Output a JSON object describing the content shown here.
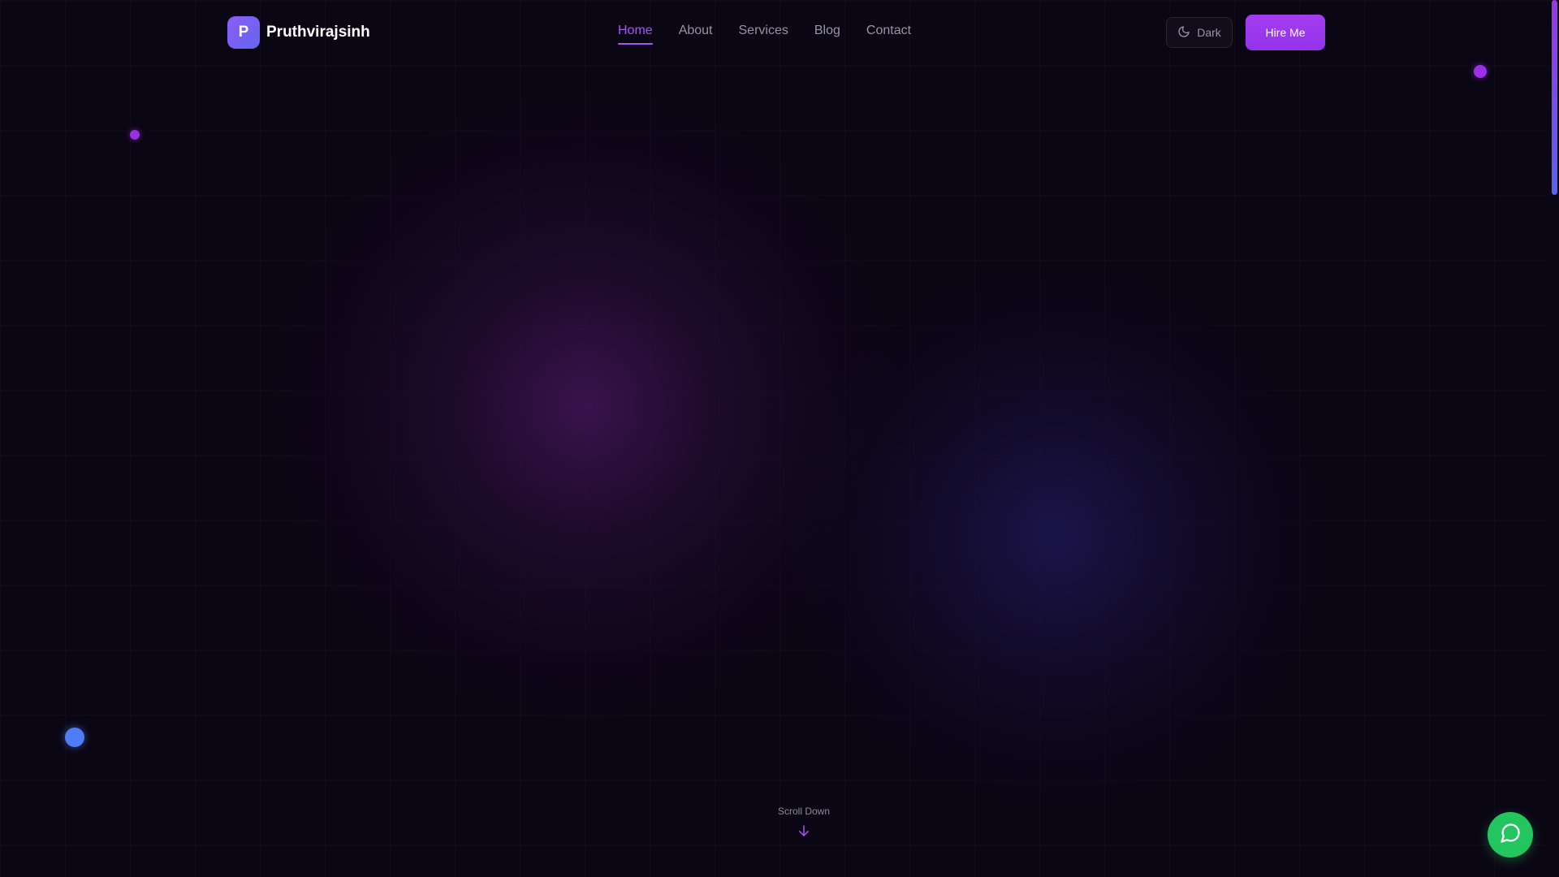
{
  "brand": {
    "initial": "P",
    "name": "Pruthvirajsinh"
  },
  "nav": {
    "items": [
      {
        "label": "Home",
        "active": true
      },
      {
        "label": "About",
        "active": false
      },
      {
        "label": "Services",
        "active": false
      },
      {
        "label": "Blog",
        "active": false
      },
      {
        "label": "Contact",
        "active": false
      }
    ]
  },
  "theme_toggle": {
    "label": "Dark",
    "icon": "moon-icon"
  },
  "hire_button": {
    "label": "Hire Me"
  },
  "hero": {
    "scroll_label": "Scroll Down",
    "scroll_icon": "arrow-down-icon"
  },
  "chat_button": {
    "icon": "chat-bubble-icon"
  },
  "colors": {
    "background": "#0b0614",
    "accent": "#a855f7",
    "accent_blue": "#4f7df5",
    "chat": "#22c55e"
  }
}
